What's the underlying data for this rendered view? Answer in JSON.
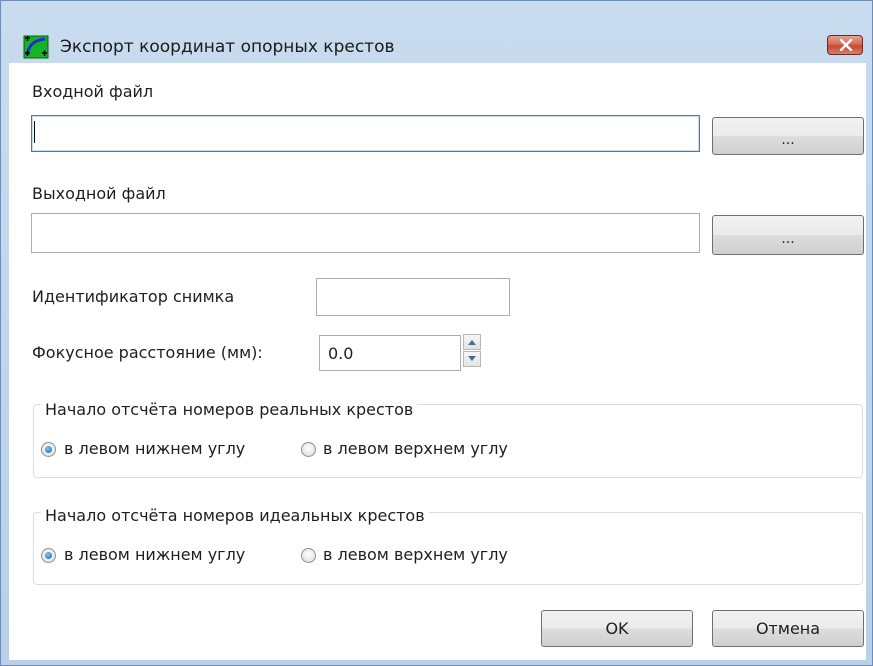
{
  "window": {
    "title": "Экспорт координат опорных крестов",
    "app_icon": "crosshair-app-icon",
    "close_icon": "close-icon"
  },
  "input_file": {
    "label": "Входной файл",
    "value": "",
    "browse_label": "..."
  },
  "output_file": {
    "label": "Выходной файл",
    "value": "",
    "browse_label": "..."
  },
  "image_id": {
    "label": "Идентификатор снимка",
    "value": ""
  },
  "focal_length": {
    "label": "Фокусное расстояние (мм):",
    "value": "0.0",
    "spin_up_icon": "arrow-up-icon",
    "spin_down_icon": "arrow-down-icon"
  },
  "real_crosses": {
    "title": "Начало отсчёта номеров реальных крестов",
    "options": [
      {
        "label": "в левом нижнем углу",
        "checked": true
      },
      {
        "label": "в левом верхнем углу",
        "checked": false
      }
    ]
  },
  "ideal_crosses": {
    "title": "Начало отсчёта номеров идеальных крестов",
    "options": [
      {
        "label": "в левом нижнем углу",
        "checked": true
      },
      {
        "label": "в левом верхнем углу",
        "checked": false
      }
    ]
  },
  "buttons": {
    "ok_label": "OK",
    "cancel_label": "Отмена"
  },
  "colors": {
    "frame": "#b9d0e8",
    "close_button": "#c24a33",
    "radio_checked": "#1c5f9e",
    "focus_border": "#3c7fb1"
  }
}
